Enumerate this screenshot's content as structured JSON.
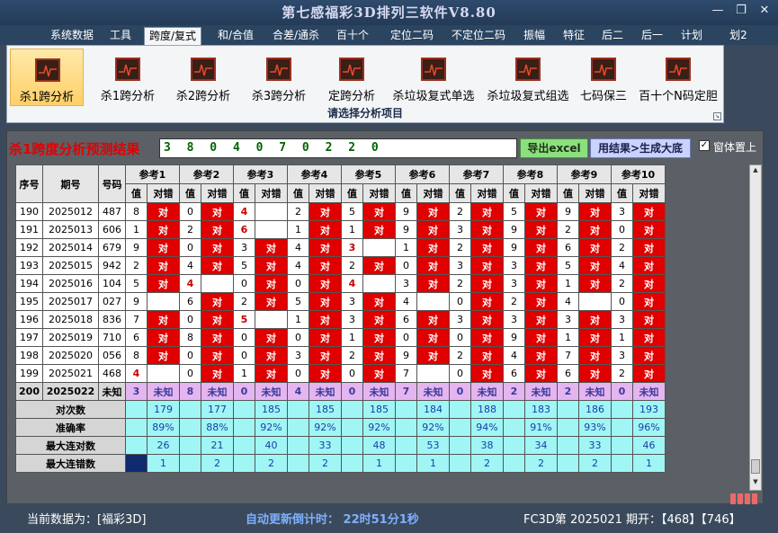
{
  "app": {
    "title": "第七感福彩3D排列三软件V8.80"
  },
  "window_controls": {
    "minimize": "—",
    "restore": "❐",
    "close": "✕"
  },
  "menu": {
    "items": [
      "系统数据",
      "工具",
      "跨度/复式",
      "和/合值",
      "合差/通杀",
      "百十个",
      "定位二码",
      "不定位二码",
      "振幅",
      "特征",
      "后二",
      "后一",
      "计划",
      "划2"
    ],
    "active_index": 2
  },
  "ribbon": {
    "buttons": [
      "杀1跨分析",
      "杀1跨分析",
      "杀2跨分析",
      "杀3跨分析",
      "定跨分析",
      "杀垃圾复式单选",
      "杀垃圾复式组选",
      "七码保三",
      "百十个N码定胆"
    ],
    "selected_index": 0,
    "caption": "请选择分析项目",
    "icon": "chart-icon"
  },
  "result": {
    "title": "杀1跨度分析预测结果",
    "value": "3 8 0 4 0 7 0 2 2 0",
    "export_label": "导出excel",
    "generate_label": "用结果>生成大底",
    "pin_checked": true,
    "pin_label": "窗体置上"
  },
  "table": {
    "headers": {
      "seq": "序号",
      "period": "期号",
      "code": "号码",
      "ref_prefix": "参考",
      "val": "值",
      "hit": "对错"
    },
    "hit_word": "对",
    "rows": [
      {
        "seq": "190",
        "period": "2025012",
        "code": "487",
        "vals": [
          "8",
          "0",
          "4",
          "2",
          "5",
          "9",
          "2",
          "5",
          "9",
          "3"
        ],
        "hits": [
          1,
          1,
          0,
          1,
          1,
          1,
          1,
          1,
          1,
          1
        ],
        "hl": [
          0,
          0,
          1,
          0,
          0,
          0,
          0,
          0,
          0,
          0
        ]
      },
      {
        "seq": "191",
        "period": "2025013",
        "code": "606",
        "vals": [
          "1",
          "2",
          "6",
          "1",
          "1",
          "9",
          "3",
          "9",
          "2",
          "0"
        ],
        "hits": [
          1,
          1,
          0,
          1,
          1,
          1,
          1,
          1,
          1,
          1
        ],
        "hl": [
          0,
          0,
          1,
          0,
          0,
          0,
          0,
          0,
          0,
          0
        ]
      },
      {
        "seq": "192",
        "period": "2025014",
        "code": "679",
        "vals": [
          "9",
          "0",
          "3",
          "4",
          "3",
          "1",
          "2",
          "9",
          "6",
          "2"
        ],
        "hits": [
          1,
          1,
          1,
          1,
          0,
          1,
          1,
          1,
          1,
          1
        ],
        "hl": [
          0,
          0,
          0,
          0,
          1,
          0,
          0,
          0,
          0,
          0
        ]
      },
      {
        "seq": "193",
        "period": "2025015",
        "code": "942",
        "vals": [
          "2",
          "4",
          "5",
          "4",
          "2",
          "0",
          "3",
          "3",
          "5",
          "4"
        ],
        "hits": [
          1,
          1,
          1,
          1,
          1,
          1,
          1,
          1,
          1,
          1
        ],
        "hl": [
          0,
          0,
          0,
          0,
          0,
          0,
          0,
          0,
          0,
          0
        ]
      },
      {
        "seq": "194",
        "period": "2025016",
        "code": "104",
        "vals": [
          "5",
          "4",
          "0",
          "0",
          "4",
          "3",
          "2",
          "3",
          "1",
          "2"
        ],
        "hits": [
          1,
          0,
          1,
          1,
          0,
          1,
          1,
          1,
          1,
          1
        ],
        "hl": [
          0,
          1,
          0,
          0,
          1,
          0,
          0,
          0,
          0,
          0
        ]
      },
      {
        "seq": "195",
        "period": "2025017",
        "code": "027",
        "vals": [
          "9",
          "6",
          "2",
          "5",
          "3",
          "4",
          "0",
          "2",
          "4",
          "0"
        ],
        "hits": [
          0,
          1,
          1,
          1,
          1,
          0,
          1,
          1,
          0,
          1
        ],
        "hl": [
          0,
          0,
          0,
          0,
          0,
          0,
          0,
          0,
          0,
          0
        ]
      },
      {
        "seq": "196",
        "period": "2025018",
        "code": "836",
        "vals": [
          "7",
          "0",
          "5",
          "1",
          "3",
          "6",
          "3",
          "3",
          "3",
          "3"
        ],
        "hits": [
          1,
          1,
          0,
          1,
          1,
          1,
          1,
          1,
          1,
          1
        ],
        "hl": [
          0,
          0,
          1,
          0,
          0,
          0,
          0,
          0,
          0,
          0
        ]
      },
      {
        "seq": "197",
        "period": "2025019",
        "code": "710",
        "vals": [
          "6",
          "8",
          "0",
          "0",
          "1",
          "0",
          "0",
          "9",
          "1",
          "1"
        ],
        "hits": [
          1,
          1,
          1,
          1,
          1,
          1,
          1,
          1,
          1,
          1
        ],
        "hl": [
          0,
          0,
          0,
          0,
          0,
          0,
          0,
          0,
          0,
          0
        ]
      },
      {
        "seq": "198",
        "period": "2025020",
        "code": "056",
        "vals": [
          "8",
          "0",
          "0",
          "3",
          "2",
          "9",
          "2",
          "4",
          "7",
          "3"
        ],
        "hits": [
          1,
          1,
          1,
          1,
          1,
          1,
          1,
          1,
          1,
          1
        ],
        "hl": [
          0,
          0,
          0,
          0,
          0,
          0,
          0,
          0,
          0,
          0
        ]
      },
      {
        "seq": "199",
        "period": "2025021",
        "code": "468",
        "vals": [
          "4",
          "0",
          "1",
          "0",
          "0",
          "7",
          "0",
          "6",
          "6",
          "2"
        ],
        "hits": [
          0,
          1,
          1,
          1,
          1,
          0,
          1,
          1,
          1,
          1
        ],
        "hl": [
          1,
          0,
          0,
          0,
          0,
          0,
          0,
          0,
          0,
          0
        ]
      }
    ],
    "next": {
      "seq": "200",
      "period": "2025022",
      "code": "未知",
      "vals": [
        "3",
        "8",
        "0",
        "4",
        "0",
        "7",
        "0",
        "2",
        "2",
        "0"
      ],
      "hit": "未知"
    },
    "stats": [
      {
        "label": "对次数",
        "values": [
          "179",
          "177",
          "185",
          "185",
          "185",
          "184",
          "188",
          "183",
          "186",
          "193"
        ]
      },
      {
        "label": "准确率",
        "values": [
          "89%",
          "88%",
          "92%",
          "92%",
          "92%",
          "92%",
          "94%",
          "91%",
          "93%",
          "96%"
        ]
      },
      {
        "label": "最大连对数",
        "values": [
          "26",
          "21",
          "40",
          "33",
          "48",
          "53",
          "38",
          "34",
          "33",
          "46"
        ]
      },
      {
        "label": "最大连错数",
        "values": [
          "1",
          "2",
          "2",
          "2",
          "1",
          "1",
          "2",
          "2",
          "2",
          "1"
        ]
      }
    ]
  },
  "status": {
    "current_data": "当前数据为：[福彩3D]",
    "countdown": "自动更新倒计时：  22时51分1秒",
    "latest": "FC3D第 2025021 期开：【468】【746】"
  }
}
